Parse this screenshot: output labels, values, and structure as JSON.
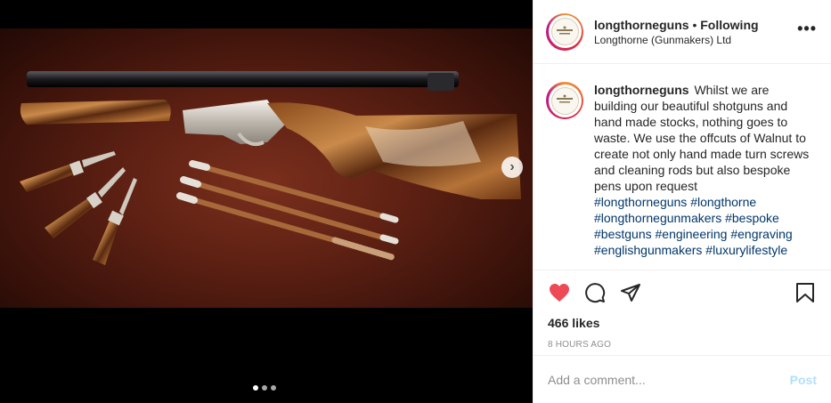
{
  "post": {
    "username": "longthorneguns",
    "separator": "•",
    "follow_status": "Following",
    "account_subtitle": "Longthorne (Gunmakers) Ltd",
    "more_label": "•••",
    "caption_text": "Whilst we are building our beautiful shotguns and hand made stocks, nothing goes to waste. We use the offcuts of Walnut to create not only hand made turn screws and cleaning rods but also bespoke pens upon request",
    "hashtags": [
      "#longthorneguns",
      "#longthorne",
      "#longthornegunmakers",
      "#bespoke",
      "#bestguns",
      "#engineering",
      "#engraving",
      "#englishgunmakers",
      "#luxurylifestyle"
    ],
    "likes": "466 likes",
    "timestamp": "8 HOURS AGO",
    "liked": true
  },
  "comment": {
    "placeholder": "Add a comment...",
    "post_label": "Post"
  },
  "carousel": {
    "next_label": "›",
    "slide_count": 3,
    "active_index": 0
  },
  "colors": {
    "like_red": "#ed4956",
    "hashtag_blue": "#00376b",
    "post_disabled": "#b2dffc"
  },
  "icons": {
    "like": "heart-icon",
    "comment": "comment-icon",
    "share": "share-icon",
    "save": "bookmark-icon",
    "more": "more-options-icon",
    "next": "chevron-right-icon"
  }
}
